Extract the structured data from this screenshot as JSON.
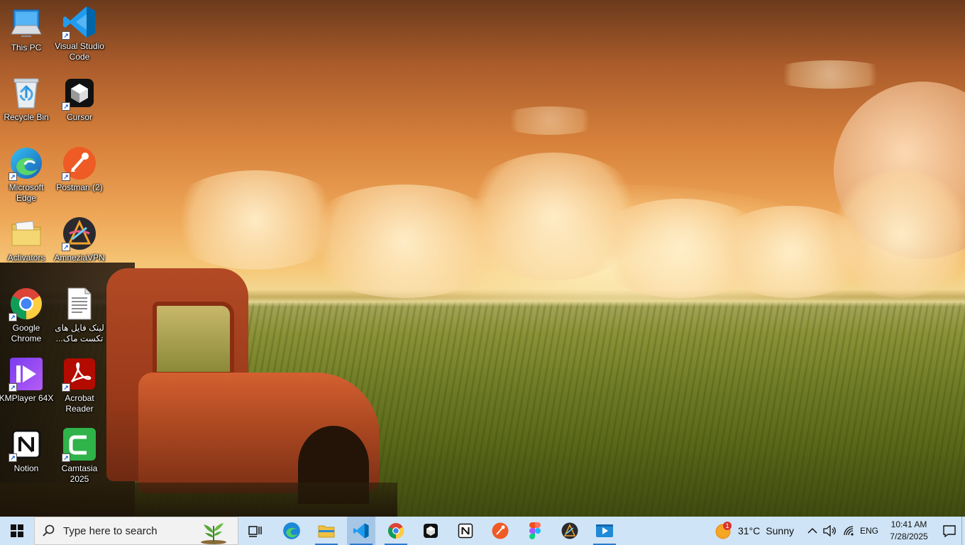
{
  "desktop": {
    "icons": [
      {
        "label": "This PC",
        "icon": "this-pc-icon"
      },
      {
        "label": "Visual Studio Code",
        "icon": "vscode-icon"
      },
      {
        "label": "Recycle Bin",
        "icon": "recycle-bin-icon"
      },
      {
        "label": "Cursor",
        "icon": "cursor-app-icon"
      },
      {
        "label": "Microsoft Edge",
        "icon": "edge-icon"
      },
      {
        "label": "Postman (2)",
        "icon": "postman-icon"
      },
      {
        "label": "Activators",
        "icon": "folder-icon"
      },
      {
        "label": "AmneziaVPN",
        "icon": "amneziavpn-icon"
      },
      {
        "label": "Google Chrome",
        "icon": "chrome-icon"
      },
      {
        "label": "لینک فایل های تکست ماک...",
        "icon": "text-file-icon"
      },
      {
        "label": "KMPlayer 64X",
        "icon": "kmplayer-icon"
      },
      {
        "label": "Acrobat Reader",
        "icon": "acrobat-icon"
      },
      {
        "label": "Notion",
        "icon": "notion-icon"
      },
      {
        "label": "Camtasia 2025",
        "icon": "camtasia-icon"
      }
    ]
  },
  "taskbar": {
    "search_placeholder": "Type here to search",
    "apps": [
      "task-view",
      "edge",
      "file-explorer",
      "vscode",
      "chrome",
      "cursor",
      "notion",
      "postman",
      "figma",
      "amneziavpn",
      "camtasia"
    ],
    "weather": {
      "badge": "1",
      "temp": "31°C",
      "condition": "Sunny"
    },
    "language": "ENG",
    "time": "10:41 AM",
    "date": "7/28/2025"
  },
  "colors": {
    "taskbar": "#cfe4f6",
    "accent": "#2b79d0"
  }
}
